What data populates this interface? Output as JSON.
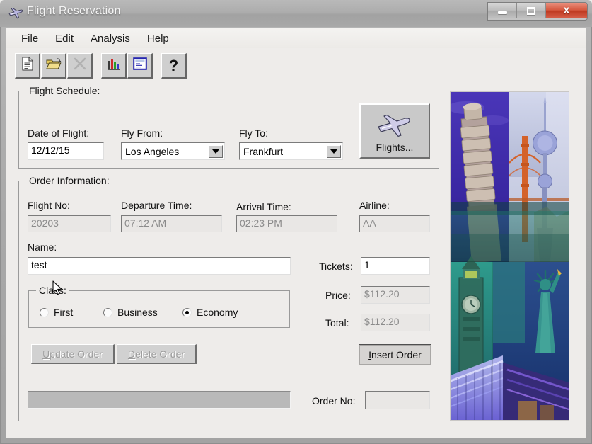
{
  "window": {
    "title": "Flight Reservation",
    "icon": "airplane-icon",
    "controls": {
      "minimize": "minimize-button",
      "maximize": "maximize-button",
      "close_label": "x"
    }
  },
  "menubar": {
    "items": [
      {
        "label": "File"
      },
      {
        "label": "Edit"
      },
      {
        "label": "Analysis"
      },
      {
        "label": "Help"
      }
    ]
  },
  "toolbar": {
    "buttons": [
      {
        "name": "new-order-icon",
        "enabled": true
      },
      {
        "name": "open-order-icon",
        "enabled": true
      },
      {
        "name": "delete-order-icon",
        "enabled": false
      },
      {
        "name": "graph-icon",
        "enabled": true
      },
      {
        "name": "fax-order-icon",
        "enabled": true
      },
      {
        "name": "help-icon",
        "label": "?",
        "enabled": true
      }
    ]
  },
  "flight_schedule": {
    "group_title": "Flight Schedule:",
    "date_label": "Date of Flight:",
    "date_value": "12/12/15",
    "fly_from_label": "Fly From:",
    "fly_from_value": "Los Angeles",
    "fly_to_label": "Fly To:",
    "fly_to_value": "Frankfurt",
    "flights_button_label": "Flights..."
  },
  "order_information": {
    "group_title": "Order Information:",
    "flight_no_label": "Flight No:",
    "flight_no_value": "20203",
    "departure_time_label": "Departure Time:",
    "departure_time_value": "07:12 AM",
    "arrival_time_label": "Arrival Time:",
    "arrival_time_value": "02:23 PM",
    "airline_label": "Airline:",
    "airline_value": "AA",
    "name_label": "Name:",
    "name_value": "test",
    "tickets_label": "Tickets:",
    "tickets_value": "1",
    "price_label": "Price:",
    "price_value": "$112.20",
    "total_label": "Total:",
    "total_value": "$112.20",
    "class_group_title": "Class:",
    "class_options": [
      {
        "label": "First",
        "selected": false
      },
      {
        "label": "Business",
        "selected": false
      },
      {
        "label": "Economy",
        "selected": true
      }
    ],
    "update_order_accel": "U",
    "update_order_rest": "pdate Order",
    "delete_order_accel": "D",
    "delete_order_rest": "elete Order",
    "insert_order_accel": "I",
    "insert_order_rest": "nsert Order"
  },
  "status": {
    "progress_value": "",
    "order_no_label": "Order No:",
    "order_no_value": ""
  },
  "picture": {
    "name": "travel-collage-image",
    "tiles": [
      "leaning-tower-of-pisa",
      "tv-tower",
      "golden-gate-bridge",
      "big-ben",
      "statue-of-liberty",
      "illuminated-building"
    ]
  },
  "colors": {
    "title_bar": "#a8a8a8",
    "close_button": "#c03a21",
    "client_background": "#eeecea",
    "field_border": "#7b7b7b",
    "disabled_text": "#8b8b8b"
  }
}
